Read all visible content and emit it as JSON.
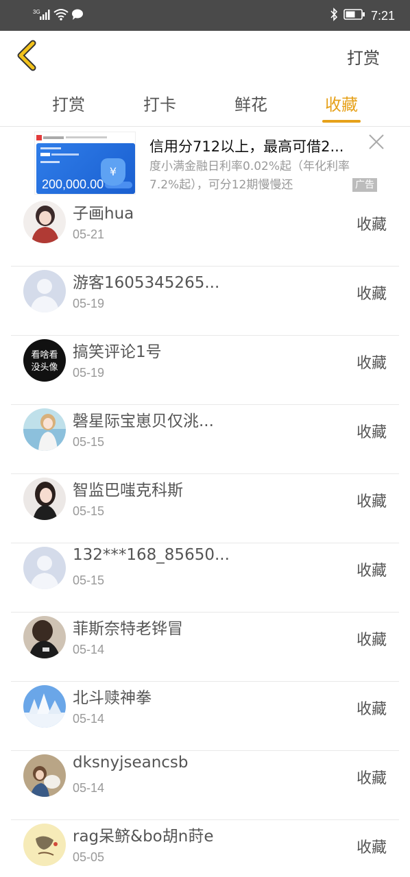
{
  "status_bar": {
    "signal": "3G",
    "time": "7:21"
  },
  "header": {
    "action_label": "打赏"
  },
  "tabs": [
    {
      "label": "打赏"
    },
    {
      "label": "打卡"
    },
    {
      "label": "鲜花"
    },
    {
      "label": "收藏"
    }
  ],
  "active_tab": "收藏",
  "ad": {
    "title": "信用分712以上，最高可借2...",
    "description": "度小满金融日利率0.02%起（年化利率 7.2%起），可分12期慢慢还",
    "badge": "广告",
    "thumb_amount": "200,000.00"
  },
  "list": [
    {
      "name": "子画hua",
      "date": "05-21",
      "action": "收藏"
    },
    {
      "name": "游客1605345265...",
      "date": "05-19",
      "action": "收藏"
    },
    {
      "name": "搞笑评论1号",
      "date": "05-19",
      "action": "收藏",
      "avatar_text": "看啥看没头像"
    },
    {
      "name": "磬星际宝崽贝仅洮...",
      "date": "05-15",
      "action": "收藏"
    },
    {
      "name": "智监巴嗤克科斯",
      "date": "05-15",
      "action": "收藏"
    },
    {
      "name": "132***168_85650...",
      "date": "05-15",
      "action": "收藏"
    },
    {
      "name": "菲斯奈特老铧冒",
      "date": "05-14",
      "action": "收藏"
    },
    {
      "name": "北斗赎神拳",
      "date": "05-14",
      "action": "收藏"
    },
    {
      "name": "dksnyjseancsb",
      "date": "05-14",
      "action": "收藏"
    },
    {
      "name": "rag呆鲚&bo胡n莳e",
      "date": "05-05",
      "action": "收藏"
    }
  ],
  "colors": {
    "accent": "#e6a11a",
    "status_bar": "#4a4a4a"
  }
}
